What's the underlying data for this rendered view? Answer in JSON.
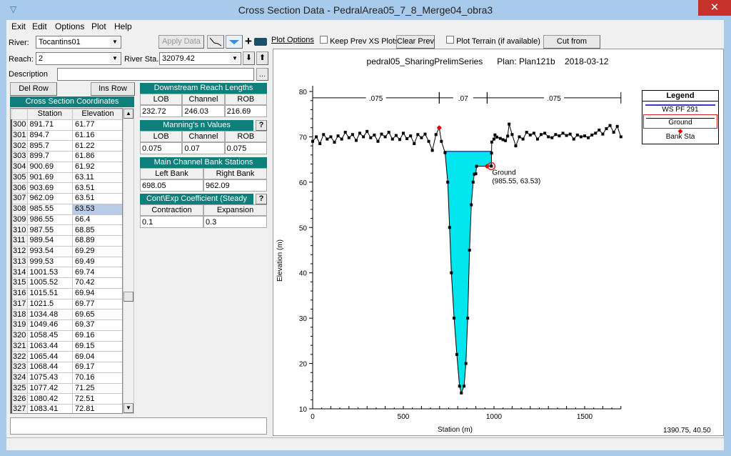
{
  "window": {
    "title": "Cross Section Data - PedralArea05_7_8_Merge04_obra3",
    "close": "✕"
  },
  "menu": [
    "Exit",
    "Edit",
    "Options",
    "Plot",
    "Help"
  ],
  "river": {
    "label": "River:",
    "value": "Tocantins01"
  },
  "reach": {
    "label": "Reach:",
    "value": "2"
  },
  "river_sta": {
    "label": "River Sta.:",
    "value": "32079.42"
  },
  "description": {
    "label": "Description",
    "value": "",
    "ellipsis": "..."
  },
  "toolbar": {
    "apply": "Apply Data",
    "plus": "+",
    "down": "⬇",
    "up": "⬆"
  },
  "buttons": {
    "del_row": "Del Row",
    "ins_row": "Ins Row"
  },
  "xs_coords": {
    "title": "Cross Section Coordinates",
    "headers": [
      "Station",
      "Elevation"
    ],
    "rows": [
      [
        "300",
        "891.71",
        "61.77"
      ],
      [
        "301",
        "894.7",
        "61.16"
      ],
      [
        "302",
        "895.7",
        "61.22"
      ],
      [
        "303",
        "899.7",
        "61.86"
      ],
      [
        "304",
        "900.69",
        "61.92"
      ],
      [
        "305",
        "901.69",
        "63.11"
      ],
      [
        "306",
        "903.69",
        "63.51"
      ],
      [
        "307",
        "962.09",
        "63.51"
      ],
      [
        "308",
        "985.55",
        "63.53"
      ],
      [
        "309",
        "986.55",
        "66.4"
      ],
      [
        "310",
        "987.55",
        "68.85"
      ],
      [
        "311",
        "989.54",
        "68.89"
      ],
      [
        "312",
        "993.54",
        "69.29"
      ],
      [
        "313",
        "999.53",
        "69.49"
      ],
      [
        "314",
        "1001.53",
        "69.74"
      ],
      [
        "315",
        "1005.52",
        "70.42"
      ],
      [
        "316",
        "1015.51",
        "69.94"
      ],
      [
        "317",
        "1021.5",
        "69.77"
      ],
      [
        "318",
        "1034.48",
        "69.65"
      ],
      [
        "319",
        "1049.46",
        "69.37"
      ],
      [
        "320",
        "1058.45",
        "69.16"
      ],
      [
        "321",
        "1063.44",
        "69.15"
      ],
      [
        "322",
        "1065.44",
        "69.04"
      ],
      [
        "323",
        "1068.44",
        "69.17"
      ],
      [
        "324",
        "1075.43",
        "70.16"
      ],
      [
        "325",
        "1077.42",
        "71.25"
      ],
      [
        "326",
        "1080.42",
        "72.51"
      ],
      [
        "327",
        "1083.41",
        "72.81"
      ]
    ],
    "selected_row": "308"
  },
  "reach_lengths": {
    "title": "Downstream Reach Lengths",
    "headers": [
      "LOB",
      "Channel",
      "ROB"
    ],
    "values": [
      "232.72",
      "246.03",
      "216.69"
    ]
  },
  "mannings": {
    "title": "Manning's n Values",
    "help": "?",
    "headers": [
      "LOB",
      "Channel",
      "ROB"
    ],
    "values": [
      "0.075",
      "0.07",
      "0.075"
    ]
  },
  "bank_stations": {
    "title": "Main Channel Bank Stations",
    "headers": [
      "Left Bank",
      "Right Bank"
    ],
    "values": [
      "698.05",
      "962.09"
    ]
  },
  "coefficients": {
    "title": "Cont\\Exp Coefficient (Steady",
    "help": "?",
    "headers": [
      "Contraction",
      "Expansion"
    ],
    "values": [
      "0.1",
      "0.3"
    ]
  },
  "plot_options": {
    "link": "Plot Options",
    "keep_prev": "Keep Prev XS Plots",
    "clear_prev": "Clear Prev",
    "plot_terrain": "Plot Terrain (if available)",
    "cut_terrain": "Cut from Terrain",
    "keep_prev_checked": false,
    "plot_terrain_checked": false
  },
  "cursor_readout": "1390.75, 40.50",
  "chart_data": {
    "type": "line",
    "title": "pedral05_SharingPrelimSeries      Plan: Plan121b    2018-03-12",
    "xlabel": "Station (m)",
    "ylabel": "Elevation (m)",
    "xlim": [
      0,
      1700
    ],
    "ylim": [
      10,
      80
    ],
    "xticks": [
      "0",
      "500",
      "1000",
      "1500"
    ],
    "yticks": [
      "10",
      "20",
      "30",
      "40",
      "50",
      "60",
      "70",
      "80"
    ],
    "legend": {
      "title": "Legend",
      "placement": "right",
      "entries": [
        "WS PF 291",
        "Ground",
        "Bank Sta"
      ]
    },
    "colors": {
      "ws": "#3a3ac8",
      "ground": "#000000",
      "bank": "#e00000",
      "water": "#00e5ee",
      "highlight": "#e02020"
    },
    "ws_elevation": 66.8,
    "bank_stations": [
      [
        698.05,
        72
      ],
      [
        962.09,
        63.51
      ]
    ],
    "n_values": [
      {
        "label": ".075",
        "from": 0,
        "to": 698.05
      },
      {
        "label": ".07",
        "from": 698.05,
        "to": 962.09
      },
      {
        "label": ".075",
        "from": 962.09,
        "to": 1700
      }
    ],
    "annotation": {
      "label": "Ground",
      "coords": "(985.55, 63.53)",
      "x": 985.55,
      "y": 63.53
    },
    "ground": [
      [
        0,
        69
      ],
      [
        20,
        70
      ],
      [
        40,
        68.5
      ],
      [
        60,
        70.5
      ],
      [
        80,
        69.5
      ],
      [
        100,
        70
      ],
      [
        120,
        68.8
      ],
      [
        140,
        70.2
      ],
      [
        160,
        69.5
      ],
      [
        180,
        71
      ],
      [
        200,
        69.8
      ],
      [
        220,
        70.5
      ],
      [
        240,
        69.2
      ],
      [
        260,
        70.8
      ],
      [
        280,
        70
      ],
      [
        300,
        71.2
      ],
      [
        320,
        69.8
      ],
      [
        340,
        70.4
      ],
      [
        360,
        69
      ],
      [
        380,
        70.6
      ],
      [
        400,
        70
      ],
      [
        420,
        71
      ],
      [
        440,
        69.5
      ],
      [
        460,
        70.3
      ],
      [
        480,
        69.4
      ],
      [
        500,
        70.8
      ],
      [
        520,
        69.6
      ],
      [
        540,
        70.2
      ],
      [
        560,
        68.5
      ],
      [
        580,
        70.5
      ],
      [
        600,
        69.8
      ],
      [
        620,
        70.6
      ],
      [
        640,
        69
      ],
      [
        660,
        67
      ],
      [
        680,
        70.5
      ],
      [
        698.05,
        72
      ],
      [
        710,
        69
      ],
      [
        730,
        66.5
      ],
      [
        745,
        60
      ],
      [
        755,
        50
      ],
      [
        765,
        40
      ],
      [
        780,
        30
      ],
      [
        795,
        22
      ],
      [
        810,
        15
      ],
      [
        820,
        13.5
      ],
      [
        835,
        15
      ],
      [
        845,
        20
      ],
      [
        855,
        30
      ],
      [
        865,
        45
      ],
      [
        875,
        55
      ],
      [
        885,
        60
      ],
      [
        891.71,
        61.77
      ],
      [
        899.7,
        61.86
      ],
      [
        903.69,
        63.51
      ],
      [
        962.09,
        63.51
      ],
      [
        985.55,
        63.53
      ],
      [
        986.55,
        66.4
      ],
      [
        987.55,
        68.85
      ],
      [
        999.53,
        69.49
      ],
      [
        1005.52,
        70.42
      ],
      [
        1015.51,
        69.94
      ],
      [
        1034.48,
        69.65
      ],
      [
        1049.46,
        69.37
      ],
      [
        1063.44,
        69.15
      ],
      [
        1075.43,
        70.16
      ],
      [
        1083.41,
        72.81
      ],
      [
        1100,
        70.5
      ],
      [
        1120,
        68
      ],
      [
        1140,
        70
      ],
      [
        1160,
        69.5
      ],
      [
        1180,
        71
      ],
      [
        1200,
        70.4
      ],
      [
        1220,
        70.8
      ],
      [
        1240,
        69.5
      ],
      [
        1260,
        70.5
      ],
      [
        1280,
        70.8
      ],
      [
        1300,
        70
      ],
      [
        1320,
        69.8
      ],
      [
        1340,
        70.5
      ],
      [
        1360,
        70.2
      ],
      [
        1380,
        70.8
      ],
      [
        1400,
        70.3
      ],
      [
        1420,
        70.6
      ],
      [
        1440,
        69.5
      ],
      [
        1460,
        70.4
      ],
      [
        1480,
        70
      ],
      [
        1500,
        70.2
      ],
      [
        1520,
        69.8
      ],
      [
        1540,
        70.4
      ],
      [
        1560,
        70.8
      ],
      [
        1580,
        71.5
      ],
      [
        1600,
        70.6
      ],
      [
        1620,
        71.8
      ],
      [
        1640,
        72.5
      ],
      [
        1660,
        71
      ],
      [
        1680,
        72.3
      ],
      [
        1700,
        70
      ]
    ]
  }
}
